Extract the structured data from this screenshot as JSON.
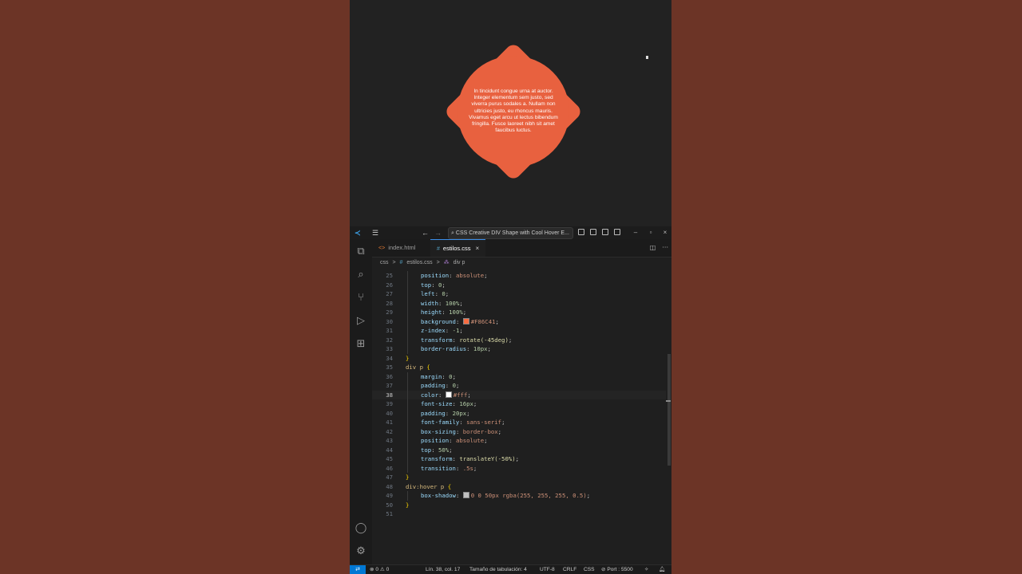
{
  "preview": {
    "shape_color": "#E8613F",
    "text": "In tincidunt congue urna at auctor. Integer elementum sem justo, sed viverra purus sodales a. Nullam non ultricies justo, eu rhoncus mauris. Vivamus eget arcu ut lectus bibendum fringilla. Fusce laoreet nibh sit amet faucibus luctus."
  },
  "titlebar": {
    "command_center": "CSS Creative DIV Shape with Cool Hover E...",
    "back_glyph": "←",
    "forward_glyph": "→",
    "minimize": "–",
    "maximize": "▫",
    "close": "×"
  },
  "activity_bar": [
    {
      "name": "explorer-icon",
      "glyph": "⧉"
    },
    {
      "name": "search-icon",
      "glyph": "⌕"
    },
    {
      "name": "source-control-icon",
      "glyph": "⑂"
    },
    {
      "name": "run-debug-icon",
      "glyph": "▷"
    },
    {
      "name": "extensions-icon",
      "glyph": "⊞"
    }
  ],
  "activity_bottom": {
    "account_glyph": "◯",
    "settings_glyph": "⚙"
  },
  "tabs": [
    {
      "label": "index.html",
      "icon": "<>",
      "active": false
    },
    {
      "label": "estilos.css",
      "icon": "#",
      "active": true,
      "close": "×"
    }
  ],
  "tab_actions": {
    "split": "◫",
    "more": "···"
  },
  "breadcrumb": {
    "folder": "css",
    "file": "estilos.css",
    "symbol": "div p",
    "separator": ">"
  },
  "code": {
    "current_line": 38,
    "lines": [
      {
        "n": "25",
        "prop": "position",
        "val": "absolute"
      },
      {
        "n": "26",
        "prop": "top",
        "val": "0"
      },
      {
        "n": "27",
        "prop": "left",
        "val": "0"
      },
      {
        "n": "28",
        "prop": "width",
        "val": "100%"
      },
      {
        "n": "29",
        "prop": "height",
        "val": "100%"
      },
      {
        "n": "30",
        "prop": "background",
        "val": "#F86C41",
        "swatch": "#F86C41"
      },
      {
        "n": "31",
        "prop": "z-index",
        "val": "-1"
      },
      {
        "n": "32",
        "prop": "transform",
        "val": "rotate(-45deg)"
      },
      {
        "n": "33",
        "prop": "border-radius",
        "val": "10px"
      },
      {
        "n": "34",
        "raw": "}"
      },
      {
        "n": "35",
        "raw": "div p {"
      },
      {
        "n": "36",
        "prop": "margin",
        "val": "0"
      },
      {
        "n": "37",
        "prop": "padding",
        "val": "0"
      },
      {
        "n": "38",
        "prop": "color",
        "val": "#fff",
        "swatch": "#FFFFFF"
      },
      {
        "n": "39",
        "prop": "font-size",
        "val": "16px"
      },
      {
        "n": "40",
        "prop": "padding",
        "val": "20px"
      },
      {
        "n": "41",
        "prop": "font-family",
        "val": "sans-serif"
      },
      {
        "n": "42",
        "prop": "box-sizing",
        "val": "border-box"
      },
      {
        "n": "43",
        "prop": "position",
        "val": "absolute"
      },
      {
        "n": "44",
        "prop": "top",
        "val": "50%"
      },
      {
        "n": "45",
        "prop": "transform",
        "val": "translateY(-50%)"
      },
      {
        "n": "46",
        "prop": "transition",
        "val": ".5s"
      },
      {
        "n": "47",
        "raw": "}"
      },
      {
        "n": "48",
        "raw": "div:hover p {"
      },
      {
        "n": "49",
        "prop": "box-shadow",
        "val": "0 0 50px rgba(255, 255, 255, 0.5)",
        "swatch": "#BFBFBF"
      },
      {
        "n": "50",
        "raw": "}"
      },
      {
        "n": "51",
        "raw": ""
      }
    ]
  },
  "statusbar": {
    "remote_glyph": "⇄",
    "problems": "⊗ 0 ⚠ 0",
    "position": "Lín. 38, col. 17",
    "tab_size": "Tamaño de tabulación: 4",
    "encoding": "UTF-8",
    "eol": "CRLF",
    "language": "CSS",
    "port": "⊘ Port : 5500",
    "copilot_glyph": "✧",
    "bell_glyph": "🔔︎"
  },
  "colors": {
    "background": "#6C3426",
    "accent": "#0078D4",
    "shape": "#E8613F"
  }
}
